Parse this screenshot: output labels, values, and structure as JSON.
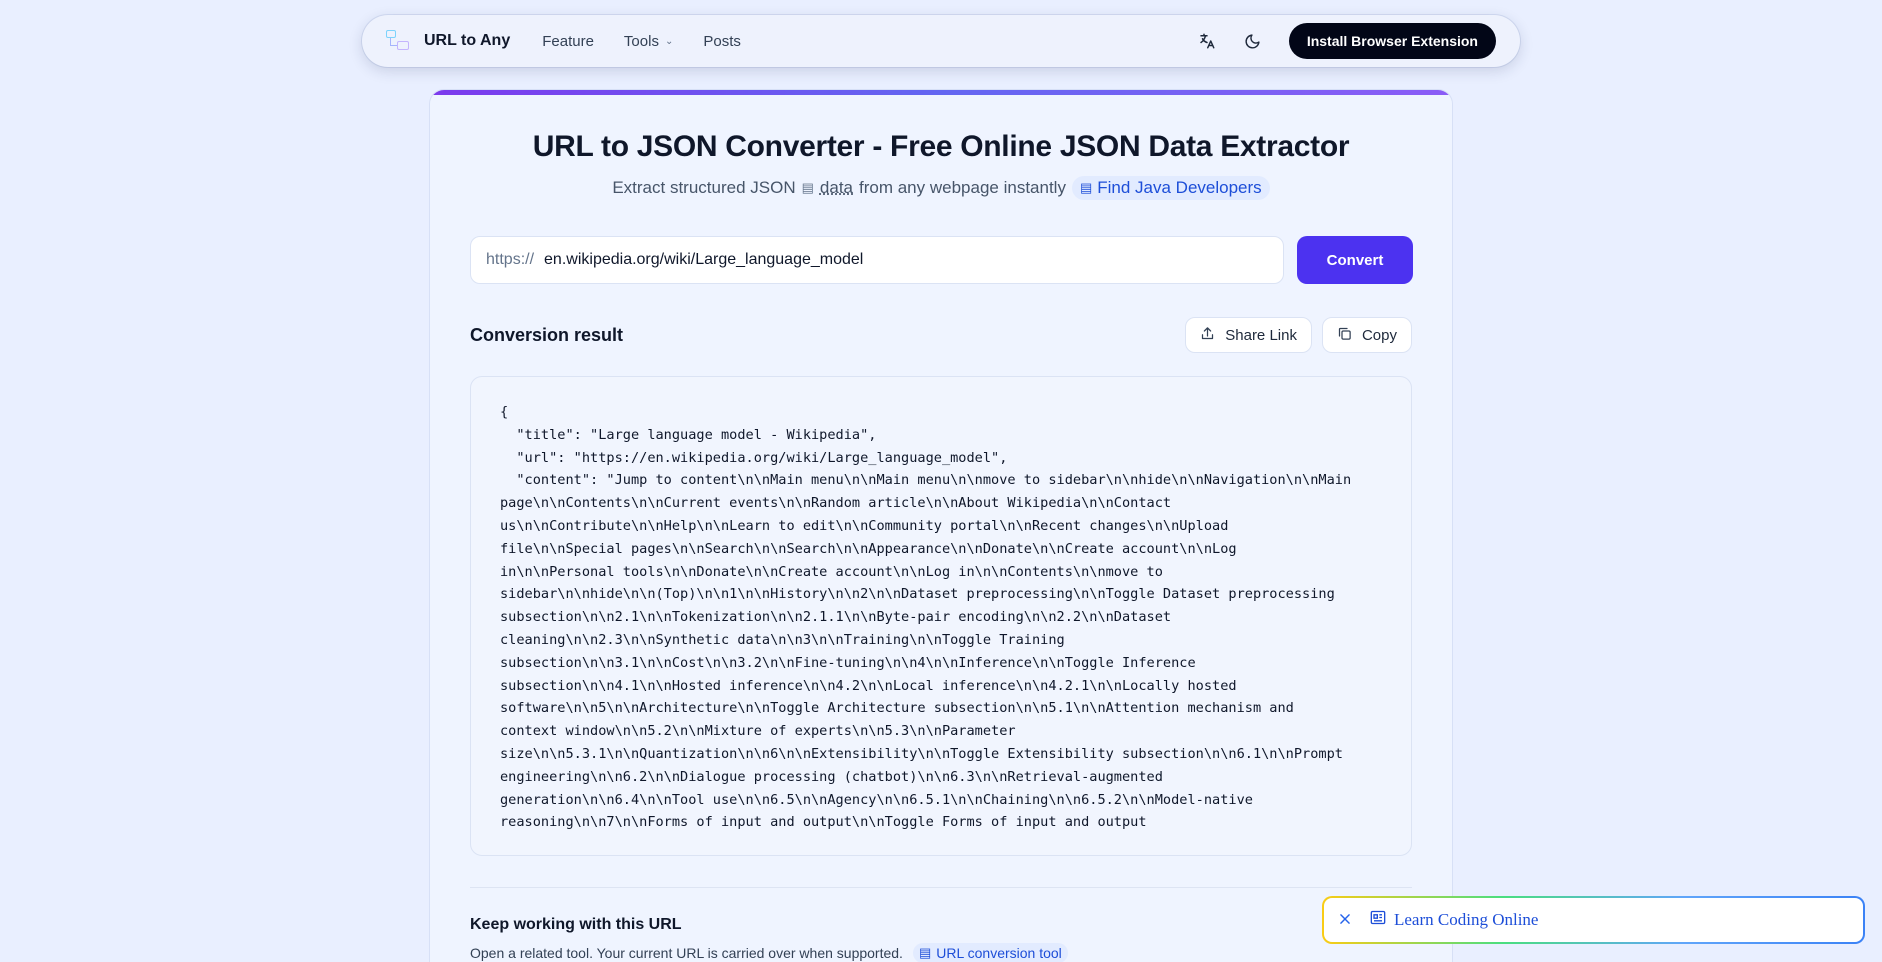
{
  "nav": {
    "brand": "URL to Any",
    "links": [
      "Feature",
      "Tools",
      "Posts"
    ],
    "install_label": "Install Browser Extension"
  },
  "header": {
    "title": "URL to JSON Converter - Free Online JSON Data Extractor",
    "subtitle_prefix": "Extract structured JSON",
    "subtitle_data": "data",
    "subtitle_suffix": "from any webpage instantly",
    "promo_link": "Find Java Developers"
  },
  "url_form": {
    "prefix": "https://",
    "value": "en.wikipedia.org/wiki/Large_language_model",
    "convert_label": "Convert"
  },
  "result": {
    "title": "Conversion result",
    "share_label": "Share Link",
    "copy_label": "Copy",
    "code": "{\n  \"title\": \"Large language model - Wikipedia\",\n  \"url\": \"https://en.wikipedia.org/wiki/Large_language_model\",\n  \"content\": \"Jump to content\\n\\nMain menu\\n\\nMain menu\\n\\nmove to sidebar\\n\\nhide\\n\\nNavigation\\n\\nMain\npage\\n\\nContents\\n\\nCurrent events\\n\\nRandom article\\n\\nAbout Wikipedia\\n\\nContact\nus\\n\\nContribute\\n\\nHelp\\n\\nLearn to edit\\n\\nCommunity portal\\n\\nRecent changes\\n\\nUpload\nfile\\n\\nSpecial pages\\n\\nSearch\\n\\nSearch\\n\\nAppearance\\n\\nDonate\\n\\nCreate account\\n\\nLog\nin\\n\\nPersonal tools\\n\\nDonate\\n\\nCreate account\\n\\nLog in\\n\\nContents\\n\\nmove to\nsidebar\\n\\nhide\\n\\n(Top)\\n\\n1\\n\\nHistory\\n\\n2\\n\\nDataset preprocessing\\n\\nToggle Dataset preprocessing\nsubsection\\n\\n2.1\\n\\nTokenization\\n\\n2.1.1\\n\\nByte-pair encoding\\n\\n2.2\\n\\nDataset\ncleaning\\n\\n2.3\\n\\nSynthetic data\\n\\n3\\n\\nTraining\\n\\nToggle Training\nsubsection\\n\\n3.1\\n\\nCost\\n\\n3.2\\n\\nFine-tuning\\n\\n4\\n\\nInference\\n\\nToggle Inference\nsubsection\\n\\n4.1\\n\\nHosted inference\\n\\n4.2\\n\\nLocal inference\\n\\n4.2.1\\n\\nLocally hosted\nsoftware\\n\\n5\\n\\nArchitecture\\n\\nToggle Architecture subsection\\n\\n5.1\\n\\nAttention mechanism and\ncontext window\\n\\n5.2\\n\\nMixture of experts\\n\\n5.3\\n\\nParameter\nsize\\n\\n5.3.1\\n\\nQuantization\\n\\n6\\n\\nExtensibility\\n\\nToggle Extensibility subsection\\n\\n6.1\\n\\nPrompt\nengineering\\n\\n6.2\\n\\nDialogue processing (chatbot)\\n\\n6.3\\n\\nRetrieval-augmented\ngeneration\\n\\n6.4\\n\\nTool use\\n\\n6.5\\n\\nAgency\\n\\n6.5.1\\n\\nChaining\\n\\n6.5.2\\n\\nModel-native\nreasoning\\n\\n7\\n\\nForms of input and output\\n\\nToggle Forms of input and output"
  },
  "keep_working": {
    "title": "Keep working with this URL",
    "desc": "Open a related tool. Your current URL is carried over when supported.",
    "link": "URL conversion tool"
  },
  "toast": {
    "text": "Learn Coding Online"
  },
  "icons": {
    "translate": "translate-icon",
    "dark_mode": "moon-icon",
    "share": "share-icon",
    "copy": "copy-icon",
    "close": "close-icon",
    "document": "document-icon"
  },
  "colors": {
    "primary": "#4c32f0",
    "install_bg": "#020617",
    "link": "#1d4ed8"
  }
}
